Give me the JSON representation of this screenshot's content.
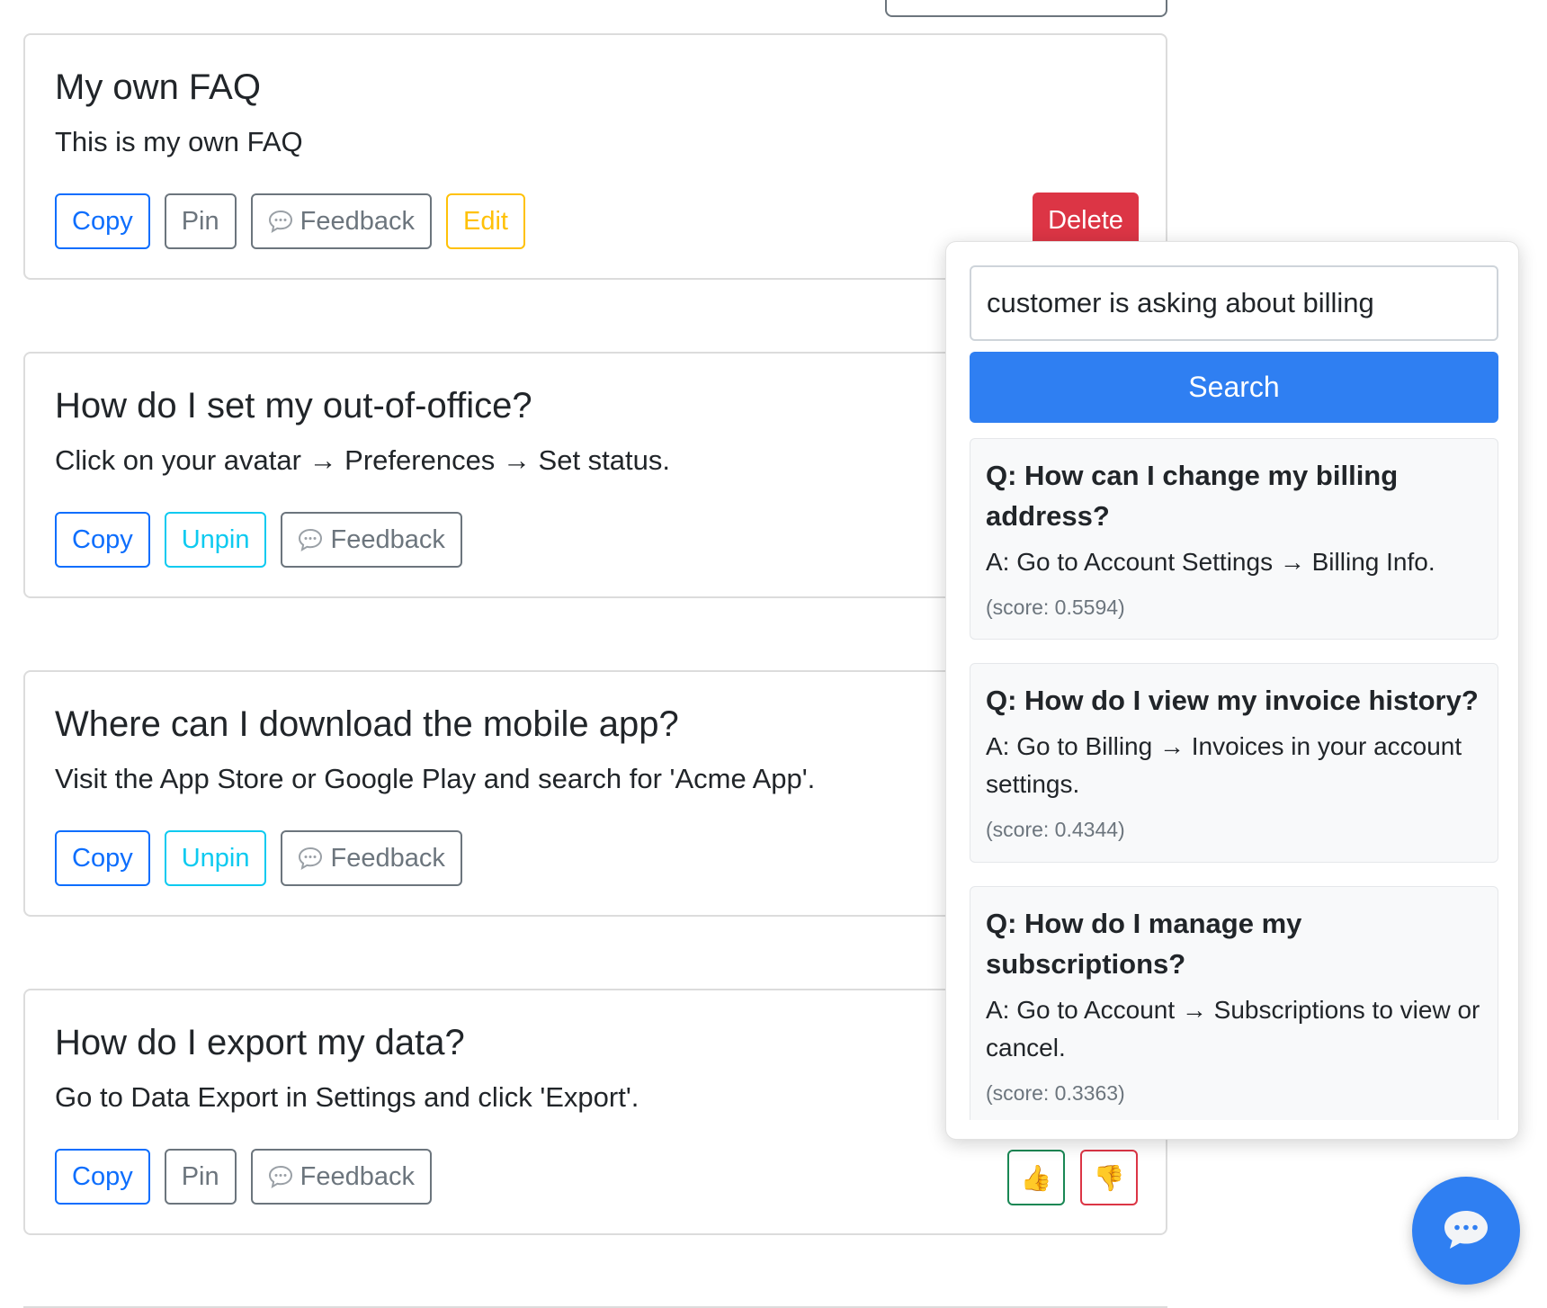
{
  "faq_cards": [
    {
      "title": "My own FAQ",
      "answer": "This is my own FAQ",
      "buttons": {
        "copy": "Copy",
        "pin": "Pin",
        "feedback": "Feedback",
        "edit": "Edit",
        "delete": "Delete"
      }
    },
    {
      "title": "How do I set my out-of-office?",
      "answer": "Click on your avatar → Preferences → Set status.",
      "buttons": {
        "copy": "Copy",
        "pin": "Unpin",
        "feedback": "Feedback"
      }
    },
    {
      "title": "Where can I download the mobile app?",
      "answer": "Visit the App Store or Google Play and search for 'Acme App'.",
      "buttons": {
        "copy": "Copy",
        "pin": "Unpin",
        "feedback": "Feedback"
      }
    },
    {
      "title": "How do I export my data?",
      "answer": "Go to Data Export in Settings and click 'Export'.",
      "buttons": {
        "copy": "Copy",
        "pin": "Pin",
        "feedback": "Feedback",
        "thumbs_up": "👍",
        "thumbs_down": "👎"
      }
    }
  ],
  "search_panel": {
    "query": "customer is asking about billing",
    "search_label": "Search",
    "results": [
      {
        "question": "Q: How can I change my billing address?",
        "answer": "A: Go to Account Settings → Billing Info.",
        "score": "(score: 0.5594)"
      },
      {
        "question": "Q: How do I view my invoice history?",
        "answer": "A: Go to Billing → Invoices in your account settings.",
        "score": "(score: 0.4344)"
      },
      {
        "question": "Q: How do I manage my subscriptions?",
        "answer": "A: Go to Account → Subscriptions to view or cancel.",
        "score": "(score: 0.3363)"
      }
    ]
  },
  "icons": {
    "feedback": "speech-bubble-icon",
    "chat_fab": "chat-bubble-icon"
  },
  "colors": {
    "primary": "#0d6efd",
    "secondary": "#6c757d",
    "info": "#0dcaf0",
    "warning": "#ffc107",
    "danger": "#dc3545",
    "success": "#198754",
    "search_button": "#2f7ff2"
  }
}
